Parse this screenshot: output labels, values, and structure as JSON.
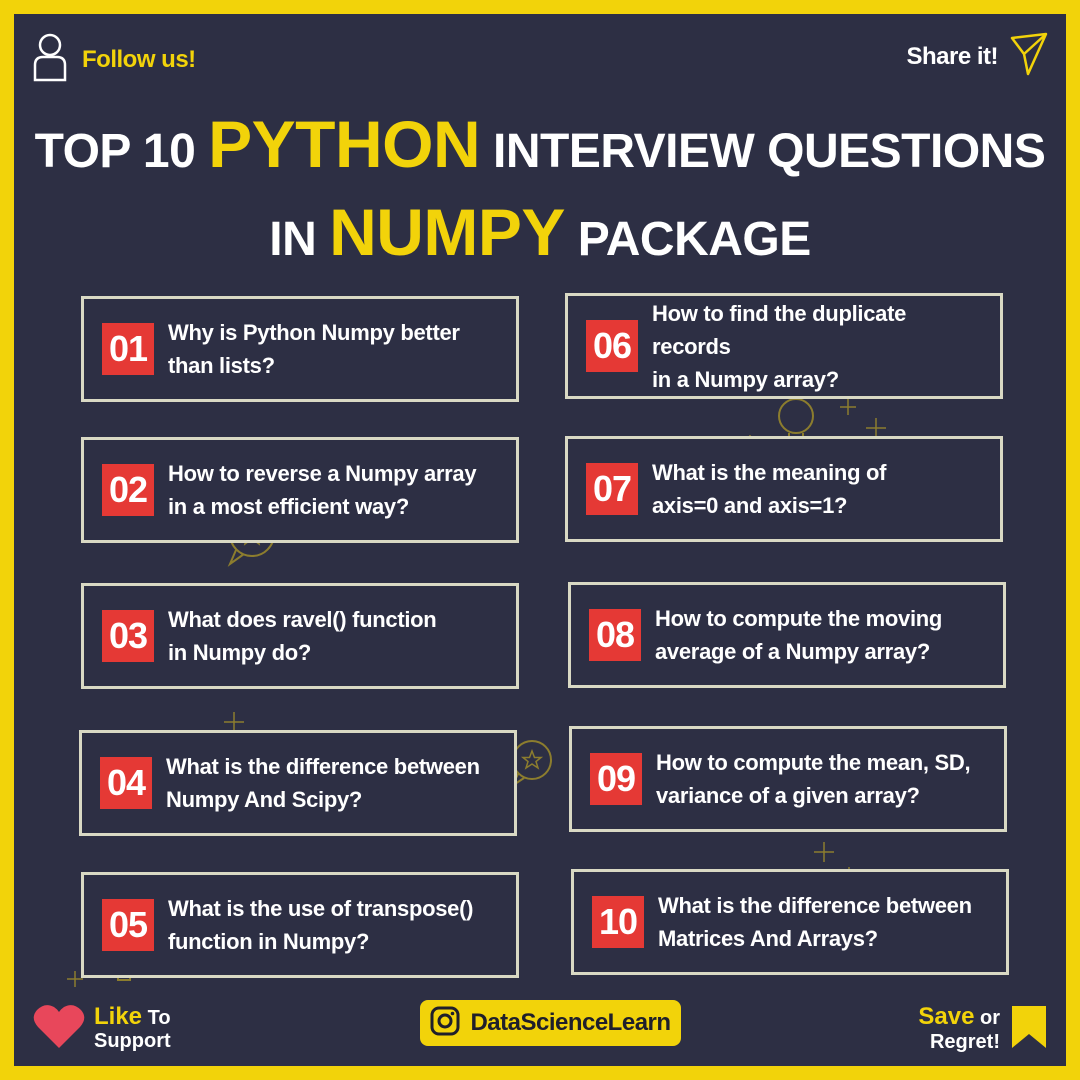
{
  "header": {
    "follow_label": "Follow us!",
    "share_label": "Share it!"
  },
  "title": {
    "line1_prefix": "TOP 10 ",
    "line1_highlight": "PYTHON",
    "line1_suffix": " INTERVIEW QUESTIONS",
    "line2_prefix": "IN ",
    "line2_highlight": "NUMPY",
    "line2_suffix": " PACKAGE"
  },
  "questions": [
    {
      "num": "01",
      "line1": "Why is Python Numpy better",
      "line2": "than lists?"
    },
    {
      "num": "02",
      "line1": "How to reverse a Numpy array",
      "line2": "in a most efficient way?"
    },
    {
      "num": "03",
      "line1": "What does ravel() function",
      "line2": "in Numpy do?"
    },
    {
      "num": "04",
      "line1": "What is the difference between",
      "line2": "Numpy And Scipy?"
    },
    {
      "num": "05",
      "line1": "What is the use of transpose()",
      "line2": "function in Numpy?"
    },
    {
      "num": "06",
      "line1": "How to find the duplicate records",
      "line2": "in a Numpy array?"
    },
    {
      "num": "07",
      "line1": "What is the meaning of",
      "line2": "axis=0 and axis=1?"
    },
    {
      "num": "08",
      "line1": "How to compute the moving",
      "line2": "average of a Numpy array?"
    },
    {
      "num": "09",
      "line1": "How to compute the mean, SD,",
      "line2": "variance of a given array?"
    },
    {
      "num": "10",
      "line1": "What is the difference between",
      "line2": "Matrices And Arrays?"
    }
  ],
  "footer": {
    "like_highlight": "Like",
    "like_rest1": " To",
    "like_rest2": "Support",
    "handle": "DataScienceLearn",
    "save_highlight": "Save",
    "save_rest1": " or",
    "save_rest2": "Regret!"
  },
  "colors": {
    "accent": "#f2d30a",
    "background": "#2d2f44",
    "badge": "#e53935"
  },
  "icons": [
    "person-icon",
    "paper-plane-icon",
    "heart-icon",
    "instagram-icon",
    "bookmark-icon"
  ]
}
